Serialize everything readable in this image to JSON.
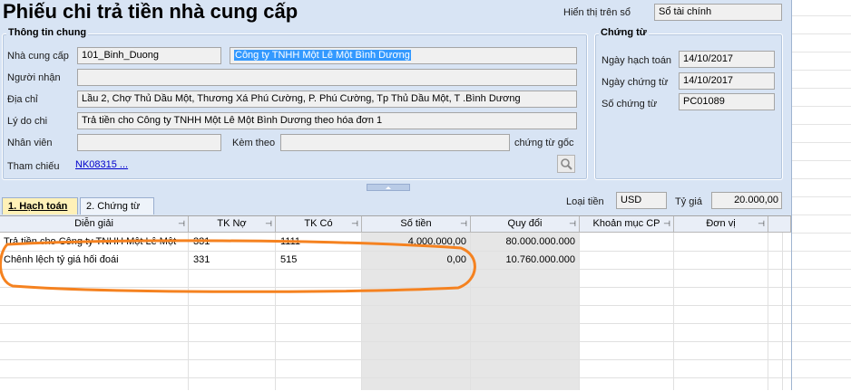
{
  "title": "Phiếu chi trả tiền nhà cung cấp",
  "display_in_book": {
    "label": "Hiển thị trên sổ",
    "value": "Sổ tài chính"
  },
  "general": {
    "group_title": "Thông tin chung",
    "supplier_label": "Nhà cung cấp",
    "supplier_code": "101_Binh_Duong",
    "supplier_name": "Công ty TNHH Một Lê Một Bình Dương",
    "receiver_label": "Người nhận",
    "receiver_value": "",
    "address_label": "Địa chỉ",
    "address_value": "Lầu 2, Chợ Thủ Dầu Một, Thương Xá Phú Cường, P. Phú Cường, Tp Thủ Dầu Một, T .Bình Dương",
    "reason_label": "Lý do chi",
    "reason_value": "Trả tiền cho Công ty TNHH Một Lê Một Bình Dương theo hóa đơn 1",
    "employee_label": "Nhân viên",
    "employee_value": "",
    "attach_label": "Kèm theo",
    "attach_value": "",
    "original_docs_label": "chứng từ gốc",
    "reference_label": "Tham chiếu",
    "reference_value": "NK08315 ..."
  },
  "voucher": {
    "group_title": "Chứng từ",
    "posting_date_label": "Ngày hạch toán",
    "posting_date": "14/10/2017",
    "voucher_date_label": "Ngày chứng từ",
    "voucher_date": "14/10/2017",
    "voucher_no_label": "Số chứng từ",
    "voucher_no": "PC01089"
  },
  "tabs": [
    {
      "label": "1. Hạch toán"
    },
    {
      "label": "2. Chứng từ"
    }
  ],
  "currency": {
    "label": "Loại tiền",
    "value": "USD",
    "rate_label": "Tỷ giá",
    "rate_value": "20.000,00"
  },
  "grid": {
    "columns": [
      "Diễn giải",
      "TK Nợ",
      "TK Có",
      "Số tiền",
      "Quy đổi",
      "Khoản mục CP",
      "Đơn vị"
    ],
    "rows": [
      [
        "Trả tiền cho Công ty TNHH Một Lê Một",
        "331",
        "1111",
        "4.000.000,00",
        "80.000.000.000",
        "",
        ""
      ],
      [
        "Chênh lệch tỷ giá hối đoái",
        "331",
        "515",
        "0,00",
        "10.760.000.000",
        "",
        ""
      ]
    ]
  },
  "colors": {
    "window_bg": "#d8e4f4",
    "highlight": "#3399ff",
    "annotation": "#f58220"
  }
}
